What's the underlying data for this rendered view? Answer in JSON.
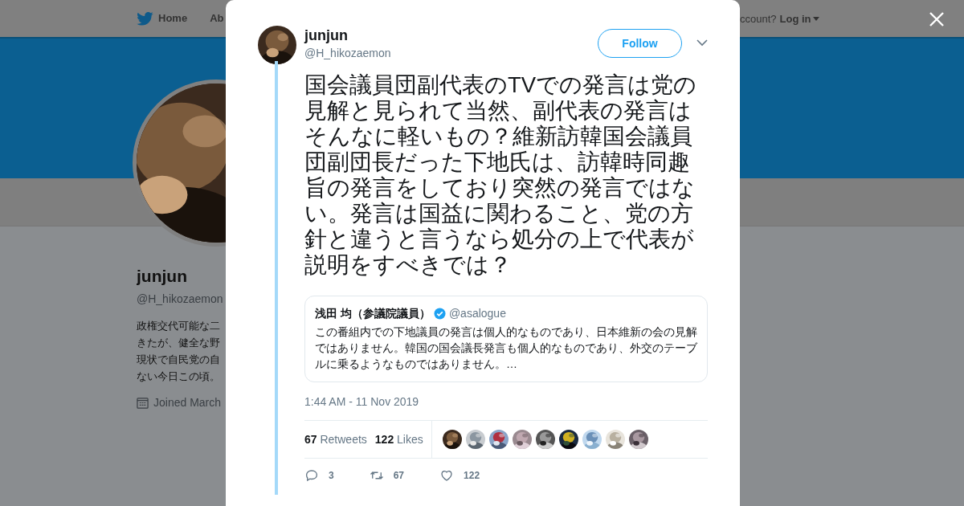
{
  "nav": {
    "items": [
      {
        "label": "Home",
        "kind": "home"
      },
      {
        "label": "Ab",
        "kind": "plain"
      }
    ],
    "account_prompt": "ccount?",
    "login": "Log in"
  },
  "profile": {
    "name": "junjun",
    "handle": "@H_hikozaemon",
    "bio": [
      "政権交代可能な二",
      "きたが、健全な野",
      "現状で自民党の自",
      "ない今日この頃。"
    ],
    "joined": "Joined March"
  },
  "tweet": {
    "author": {
      "name": "junjun",
      "handle": "@H_hikozaemon"
    },
    "follow": "Follow",
    "text": "国会議員団副代表のTVでの発言は党の見解と見られて当然、副代表の発言はそんなに軽いもの？維新訪韓国会議員団副団長だった下地氏は、訪韓時同趣旨の発言をしており突然の発言ではない。発言は国益に関わること、党の方針と違うと言うなら処分の上で代表が説明をすべきでは？",
    "quote": {
      "name": "浅田 均（参議院議員）",
      "verified": true,
      "handle": "@asalogue",
      "text": "この番組内での下地議員の発言は個人的なものであり、日本維新の会の見解ではありません。韓国の国会議長発言も個人的なものであり、外交のテーブルに乗るようなものではありません。…"
    },
    "timestamp": "1:44 AM - 11 Nov 2019",
    "stats": [
      {
        "count": "67",
        "label": "Retweets"
      },
      {
        "count": "122",
        "label": "Likes"
      }
    ],
    "actions": [
      {
        "kind": "reply",
        "count": "3"
      },
      {
        "kind": "retweet",
        "count": "67"
      },
      {
        "kind": "like",
        "count": "122"
      }
    ]
  }
}
